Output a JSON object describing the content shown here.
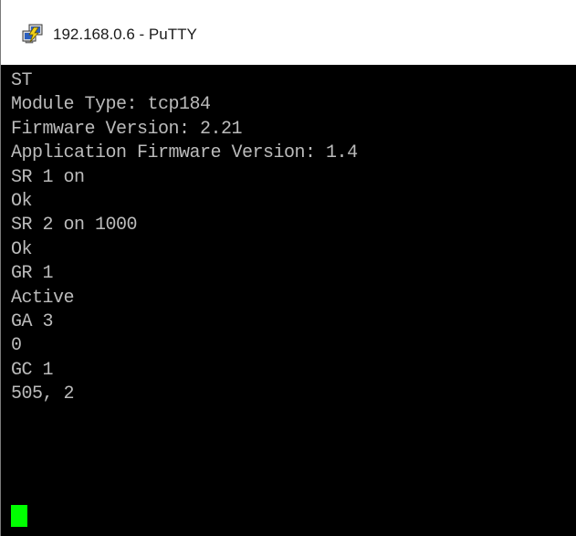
{
  "window": {
    "title": "192.168.0.6 - PuTTY",
    "app_icon": "putty-icon"
  },
  "terminal": {
    "background": "#000000",
    "text_color": "#bbbbbb",
    "cursor_color": "#00ff00",
    "lines": [
      "ST",
      "Module Type: tcp184",
      "Firmware Version: 2.21",
      "Application Firmware Version: 1.4",
      "SR 1 on",
      "Ok",
      "SR 2 on 1000",
      "Ok",
      "GR 1",
      "Active",
      "GA 3",
      "0",
      "GC 1",
      "505, 2"
    ]
  }
}
